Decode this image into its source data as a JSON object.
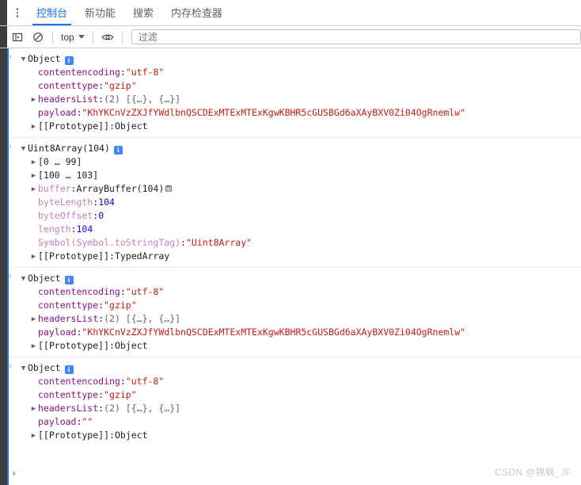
{
  "window": {
    "title": "DevTools Console"
  },
  "tabbar": {
    "more_menu_icon": "kebab-menu-icon",
    "tabs": [
      {
        "label": "控制台",
        "active": true
      },
      {
        "label": "新功能",
        "active": false
      },
      {
        "label": "搜索",
        "active": false
      },
      {
        "label": "内存检查器",
        "active": false
      }
    ]
  },
  "toolbar": {
    "sidebar_toggle_icon": "console-sidebar-icon",
    "clear_icon": "clear-console-icon",
    "context_value": "top",
    "context_caret_icon": "chevron-down-icon",
    "eye_icon": "live-expression-icon",
    "filter_placeholder": "过滤",
    "filter_value": ""
  },
  "console": {
    "message_arrow": "›",
    "prompt_caret": "›",
    "groups": [
      {
        "name": "object-group-1",
        "header": {
          "triangle": "▼",
          "label": "Object",
          "badge": "i"
        },
        "rows": [
          {
            "triangle": "",
            "key": "contentencoding",
            "sep": ": ",
            "value": "\"utf-8\"",
            "value_kind": "string"
          },
          {
            "triangle": "",
            "key": "contenttype",
            "sep": ": ",
            "value": "\"gzip\"",
            "value_kind": "string"
          },
          {
            "triangle": "▶",
            "key": "headersList",
            "sep": ": ",
            "value": "(2) [{…}, {…}]",
            "value_kind": "meta"
          },
          {
            "triangle": "",
            "key": "payload",
            "sep": ": ",
            "value": "\"KhYKCnVzZXJfYWdlbnQSCDExMTExMTExKgwKBHR5cGUSBGd6aXAyBXV0Zi04OgRnemlw\"",
            "value_kind": "string"
          },
          {
            "triangle": "▶",
            "key": "[[Prototype]]",
            "sep": ": ",
            "value": "Object",
            "value_kind": "plain",
            "key_kind": "plain"
          }
        ]
      },
      {
        "name": "uint8array-group",
        "header": {
          "triangle": "▼",
          "label": "Uint8Array(104)",
          "badge": "i"
        },
        "rows": [
          {
            "triangle": "▶",
            "key": "[0 … 99]",
            "sep": "",
            "value": "",
            "value_kind": "plain",
            "key_kind": "plain"
          },
          {
            "triangle": "▶",
            "key": "[100 … 103]",
            "sep": "",
            "value": "",
            "value_kind": "plain",
            "key_kind": "plain"
          },
          {
            "triangle": "▶",
            "key": "buffer",
            "sep": ": ",
            "value": "ArrayBuffer(104)",
            "value_kind": "plain",
            "key_kind": "dim",
            "icon": "array-buffer-icon"
          },
          {
            "triangle": "",
            "key": "byteLength",
            "sep": ": ",
            "value": "104",
            "value_kind": "number",
            "key_kind": "dim"
          },
          {
            "triangle": "",
            "key": "byteOffset",
            "sep": ": ",
            "value": "0",
            "value_kind": "number",
            "key_kind": "dim"
          },
          {
            "triangle": "",
            "key": "length",
            "sep": ": ",
            "value": "104",
            "value_kind": "number",
            "key_kind": "dim"
          },
          {
            "triangle": "",
            "key": "Symbol(Symbol.toStringTag)",
            "sep": ": ",
            "value": "\"Uint8Array\"",
            "value_kind": "string",
            "key_kind": "dim"
          },
          {
            "triangle": "▶",
            "key": "[[Prototype]]",
            "sep": ": ",
            "value": "TypedArray",
            "value_kind": "plain",
            "key_kind": "plain"
          }
        ]
      },
      {
        "name": "object-group-2",
        "header": {
          "triangle": "▼",
          "label": "Object",
          "badge": "i"
        },
        "rows": [
          {
            "triangle": "",
            "key": "contentencoding",
            "sep": ": ",
            "value": "\"utf-8\"",
            "value_kind": "string"
          },
          {
            "triangle": "",
            "key": "contenttype",
            "sep": ": ",
            "value": "\"gzip\"",
            "value_kind": "string"
          },
          {
            "triangle": "▶",
            "key": "headersList",
            "sep": ": ",
            "value": "(2) [{…}, {…}]",
            "value_kind": "meta"
          },
          {
            "triangle": "",
            "key": "payload",
            "sep": ": ",
            "value": "\"KhYKCnVzZXJfYWdlbnQSCDExMTExMTExKgwKBHR5cGUSBGd6aXAyBXV0Zi04OgRnemlw\"",
            "value_kind": "string"
          },
          {
            "triangle": "▶",
            "key": "[[Prototype]]",
            "sep": ": ",
            "value": "Object",
            "value_kind": "plain",
            "key_kind": "plain"
          }
        ]
      },
      {
        "name": "object-group-3",
        "header": {
          "triangle": "▼",
          "label": "Object",
          "badge": "i"
        },
        "rows": [
          {
            "triangle": "",
            "key": "contentencoding",
            "sep": ": ",
            "value": "\"utf-8\"",
            "value_kind": "string"
          },
          {
            "triangle": "",
            "key": "contenttype",
            "sep": ": ",
            "value": "\"gzip\"",
            "value_kind": "string"
          },
          {
            "triangle": "▶",
            "key": "headersList",
            "sep": ": ",
            "value": "(2) [{…}, {…}]",
            "value_kind": "meta"
          },
          {
            "triangle": "",
            "key": "payload",
            "sep": ": ",
            "value": "\"\"",
            "value_kind": "string"
          },
          {
            "triangle": "▶",
            "key": "[[Prototype]]",
            "sep": ": ",
            "value": "Object",
            "value_kind": "plain",
            "key_kind": "plain"
          }
        ]
      }
    ]
  },
  "watermark": {
    "text": "CSDN @锦枫_JF"
  },
  "colors": {
    "accent": "#1a73e8",
    "string": "#c41a16",
    "key": "#881280",
    "number": "#1c00cf",
    "meta": "#5f6368",
    "gutter": "#3c3c3c"
  }
}
